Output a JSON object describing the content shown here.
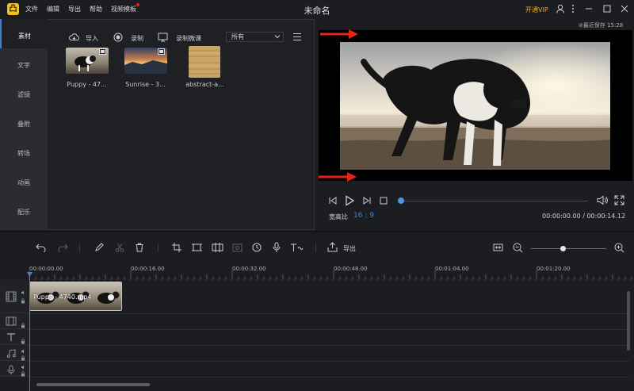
{
  "app": {
    "logo_text": "凸",
    "title": "未命名"
  },
  "menu": {
    "file": "文件",
    "edit": "编辑",
    "export": "导出",
    "help": "帮助",
    "templates": "视频模板"
  },
  "header": {
    "vip_label": "开通VIP"
  },
  "sidebar": {
    "items": [
      {
        "label": "素材"
      },
      {
        "label": "文字"
      },
      {
        "label": "滤镜"
      },
      {
        "label": "叠附"
      },
      {
        "label": "转场"
      },
      {
        "label": "动画"
      },
      {
        "label": "配乐"
      }
    ]
  },
  "media": {
    "import_label": "导入",
    "record_label": "录制",
    "record_lesson_label": "录制微课",
    "filter_value": "所有",
    "items": [
      {
        "label": "Puppy - 47..."
      },
      {
        "label": "Sunrise - 3..."
      },
      {
        "label": "abstract-a..."
      }
    ]
  },
  "preview": {
    "last_saved": "⊘最近保存 15:28",
    "ratio_label": "宽高比",
    "ratio_value": "16 : 9",
    "timecode": "00:00:00.00 / 00:00:14.12",
    "progress": 0
  },
  "timeline": {
    "export_label": "导出",
    "zoom_level": 0.43,
    "ticks": [
      "00:00:00.00",
      "00:00:16.00",
      "00:00:32.00",
      "00:00:48.00",
      "00:01:04.00",
      "00:01:20.00"
    ],
    "clip_label": "Puppy - 4740.mp4"
  },
  "colors": {
    "accent": "#3a8ae0",
    "vip": "#f0a92c",
    "logo": "#f6c21a",
    "arrow": "#e52419",
    "clip_border": "#e2c36a"
  }
}
